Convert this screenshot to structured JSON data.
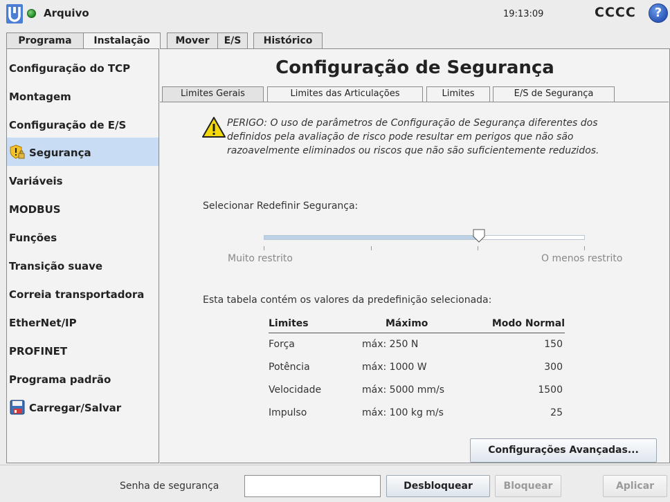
{
  "topbar": {
    "app_menu_label": "Arquivo",
    "clock": "19:13:09",
    "robot_name": "CCCC",
    "help_label": "?"
  },
  "main_tabs": [
    "Programa",
    "Instalação",
    "Mover",
    "E/S",
    "Histórico"
  ],
  "sidebar": {
    "items": [
      {
        "label": "Configuração do TCP"
      },
      {
        "label": "Montagem"
      },
      {
        "label": "Configuração de E/S"
      },
      {
        "label": "Segurança",
        "icon": "shield-lock-icon",
        "selected": true
      },
      {
        "label": "Variáveis"
      },
      {
        "label": "MODBUS"
      },
      {
        "label": "Funções"
      },
      {
        "label": "Transição suave"
      },
      {
        "label": "Correia transportadora"
      },
      {
        "label": "EtherNet/IP"
      },
      {
        "label": "PROFINET"
      },
      {
        "label": "Programa padrão"
      },
      {
        "label": "Carregar/Salvar",
        "icon": "save-disk-icon"
      }
    ]
  },
  "page": {
    "title": "Configuração de Segurança",
    "sub_tabs": [
      "Limites Gerais",
      "Limites das Articulações",
      "Limites",
      "E/S de Segurança"
    ],
    "warning": "PERIGO: O uso de parâmetros de Configuração de Segurança diferentes dos definidos pela avaliação de risco pode resultar em perigos que não são razoavelmente eliminados ou riscos que não são suficientemente reduzidos.",
    "preset_label": "Selecionar Redefinir Segurança:",
    "slider": {
      "min_label": "Muito restrito",
      "max_label": "O menos restrito",
      "value_fraction": 0.67
    },
    "table_caption": "Esta tabela contém os valores da predefinição selecionada:",
    "table": {
      "headers": [
        "Limites",
        "Máximo",
        "Modo Normal"
      ],
      "rows": [
        [
          "Força",
          "máx: 250 N",
          "150"
        ],
        [
          "Potência",
          "máx: 1000 W",
          "300"
        ],
        [
          "Velocidade",
          "máx: 5000 mm/s",
          "1500"
        ],
        [
          "Impulso",
          "máx: 100 kg m/s",
          "25"
        ]
      ]
    },
    "advanced_button": "Configurações Avançadas..."
  },
  "footer": {
    "password_label": "Senha de segurança",
    "password_value": "",
    "unlock_button": "Desbloquear",
    "lock_button": "Bloquear",
    "apply_button": "Aplicar"
  },
  "colors": {
    "selected_bg": "#c8dcf4",
    "panel_bg": "#f3f3f3",
    "window_bg": "#ececec"
  }
}
